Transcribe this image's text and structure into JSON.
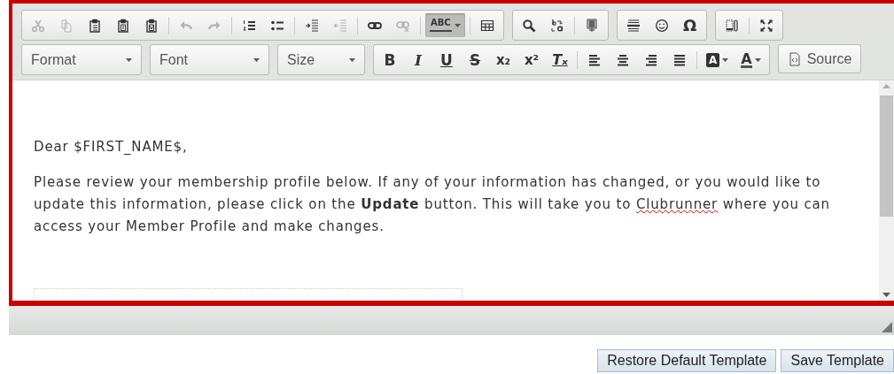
{
  "toolbar": {
    "rows": [
      [
        [
          [
            {
              "kind": "icon",
              "disabled": true,
              "on": false
            },
            {
              "kind": "icon",
              "disabled": true,
              "on": false
            },
            {
              "kind": "icon",
              "disabled": false,
              "on": false
            },
            {
              "kind": "icon",
              "disabled": false,
              "on": false
            },
            {
              "kind": "icon",
              "disabled": false,
              "on": false
            }
          ],
          [
            {
              "kind": "icon",
              "disabled": true,
              "on": false
            },
            {
              "kind": "icon",
              "disabled": true,
              "on": false
            }
          ],
          [
            {
              "kind": "icon",
              "disabled": false,
              "on": false
            },
            {
              "kind": "icon",
              "disabled": false,
              "on": false
            }
          ],
          [
            {
              "kind": "icon",
              "disabled": false,
              "on": false
            },
            {
              "kind": "icon",
              "disabled": true,
              "on": false
            }
          ],
          [
            {
              "kind": "icon",
              "disabled": false,
              "on": false
            },
            {
              "kind": "icon",
              "disabled": true,
              "on": false
            }
          ],
          [
            {
              "kind": "spellcheck",
              "glyph": "ABC",
              "disabled": false,
              "on": true
            }
          ],
          [
            {
              "kind": "icon",
              "disabled": false,
              "on": false
            }
          ]
        ],
        [
          [
            {
              "kind": "icon",
              "disabled": false,
              "on": false
            },
            {
              "kind": "icon",
              "disabled": false,
              "on": false
            }
          ],
          [
            {
              "kind": "icon",
              "disabled": false,
              "on": false
            }
          ]
        ],
        [
          [
            {
              "kind": "icon",
              "disabled": false,
              "on": false
            },
            {
              "kind": "icon",
              "disabled": false,
              "on": false
            },
            {
              "kind": "glyph",
              "glyph": "Ω",
              "disabled": false,
              "on": false
            }
          ]
        ],
        [
          [
            {
              "kind": "icon",
              "disabled": false,
              "on": false
            }
          ],
          [
            {
              "kind": "icon",
              "disabled": false,
              "on": false
            }
          ]
        ]
      ],
      [
        [
          [
            {
              "kind": "combo",
              "label": "Format"
            }
          ]
        ]
      ],
      [
        [
          [
            {
              "kind": "combo",
              "label": "Font"
            }
          ]
        ]
      ],
      [
        [
          [
            {
              "kind": "combo",
              "label": "Size"
            }
          ]
        ]
      ],
      [
        [
          [
            {
              "kind": "bold",
              "glyph": "B",
              "disabled": false,
              "on": false
            },
            {
              "kind": "italic",
              "glyph": "I",
              "disabled": false,
              "on": false
            },
            {
              "kind": "underline",
              "glyph": "U",
              "disabled": false,
              "on": false
            },
            {
              "kind": "strike",
              "glyph": "S",
              "disabled": false,
              "on": false
            },
            {
              "kind": "glyph",
              "glyph": "x₂",
              "disabled": false,
              "on": false
            },
            {
              "kind": "glyph",
              "glyph": "x²",
              "disabled": false,
              "on": false
            },
            {
              "kind": "clear",
              "glyph": "Tₓ",
              "disabled": false,
              "on": false
            }
          ],
          [
            {
              "kind": "icon",
              "disabled": false,
              "on": false
            },
            {
              "kind": "icon",
              "disabled": false,
              "on": false
            },
            {
              "kind": "icon",
              "disabled": false,
              "on": false
            },
            {
              "kind": "icon",
              "disabled": false,
              "on": false
            }
          ],
          [
            {
              "kind": "bg_color",
              "glyph": "A",
              "disabled": false,
              "on": false
            },
            {
              "kind": "text_color",
              "glyph": "A",
              "disabled": false,
              "on": false
            }
          ]
        ],
        [
          [
            {
              "kind": "text_button",
              "label": "Source"
            }
          ]
        ]
      ]
    ]
  },
  "body": {
    "greeting": "Dear $FIRST_NAME$,",
    "paragraph": [
      {
        "text": "Please review your membership profile below. If any of your information has changed, or you would like to update this information, please click on the ",
        "bold": false,
        "misspelled": false
      },
      {
        "text": "Update",
        "bold": true,
        "misspelled": false
      },
      {
        "text": " button. This will take you to ",
        "bold": false,
        "misspelled": false
      },
      {
        "text": "Clubrunner",
        "bold": false,
        "misspelled": true
      },
      {
        "text": " where you can access your Member Profile and make changes.",
        "bold": false,
        "misspelled": false
      }
    ]
  },
  "buttons": [
    "Restore Default Template",
    "Save Template"
  ]
}
